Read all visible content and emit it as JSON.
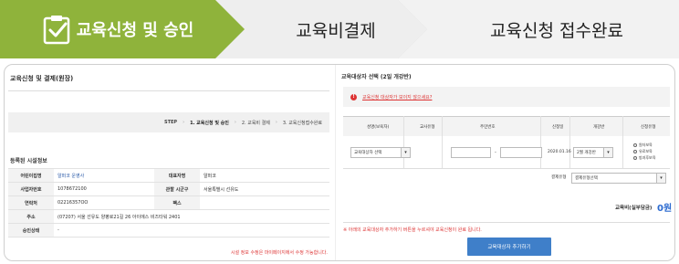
{
  "steps": {
    "step1": "교육신청 및 승인",
    "step2": "교육비결제",
    "step3": "교육신청 접수완료"
  },
  "left": {
    "page_title": "교육신청 및 결제(원장)",
    "stepbar": {
      "label": "STEP",
      "s1": "1. 교육신청 및 승인",
      "s2": "2. 교육비 결제",
      "s3": "3. 교육신청접수완료",
      "sep": "›"
    },
    "section_title": "등록된 시설정보",
    "rows": [
      {
        "k1": "어린이집명",
        "v1": "알퍼코 운영사",
        "k2": "대표자명",
        "v2": "알퍼코"
      },
      {
        "k1": "사업자번호",
        "v1": "1078672100",
        "k2": "관할 시군구",
        "v2": "서울특별시 선유도"
      },
      {
        "k1": "연락처",
        "v1": "02216357OO",
        "k2": "팩스",
        "v2": ""
      },
      {
        "k1": "주소",
        "v1": "(07207) 서울 선유도 양평로21길 26 아이에스 비즈타워 2401"
      },
      {
        "k1": "승인상태",
        "v1": "-"
      }
    ],
    "notice": "시설 정보 수정은 마이페이지에서 수정 가능합니다."
  },
  "right": {
    "title": "교육대상자 선택 (2일 개강반)",
    "alert": "교육신청 대상자가 보이지 않으세요?",
    "alert_icon": "!",
    "headers": {
      "h1": "성명(보육자)",
      "h2": "교사유형",
      "h3": "주민번호",
      "h4": "신청일",
      "h5": "개강반",
      "h6": "신청유형"
    },
    "row": {
      "person_select": "교육대상자 선택",
      "dash": "-",
      "date": "2020.01.16",
      "class_select": "2월 개강반",
      "radios": [
        "원자보육",
        "유료보육",
        "방과후보육"
      ]
    },
    "pay_label": "결제유형",
    "pay_select": "결제유형선택",
    "total_label": "교육비(실부담금)",
    "total_value": "0원",
    "notice": "※ 아래의 교육대상자 추가하기 버튼을 누르셔야 교육신청이 완료 됩니다.",
    "add_button": "교육대상자 추가하기"
  },
  "colors": {
    "accent_green": "#8fb33b",
    "button_blue": "#3f7fc9",
    "alert_red": "#d33333"
  }
}
